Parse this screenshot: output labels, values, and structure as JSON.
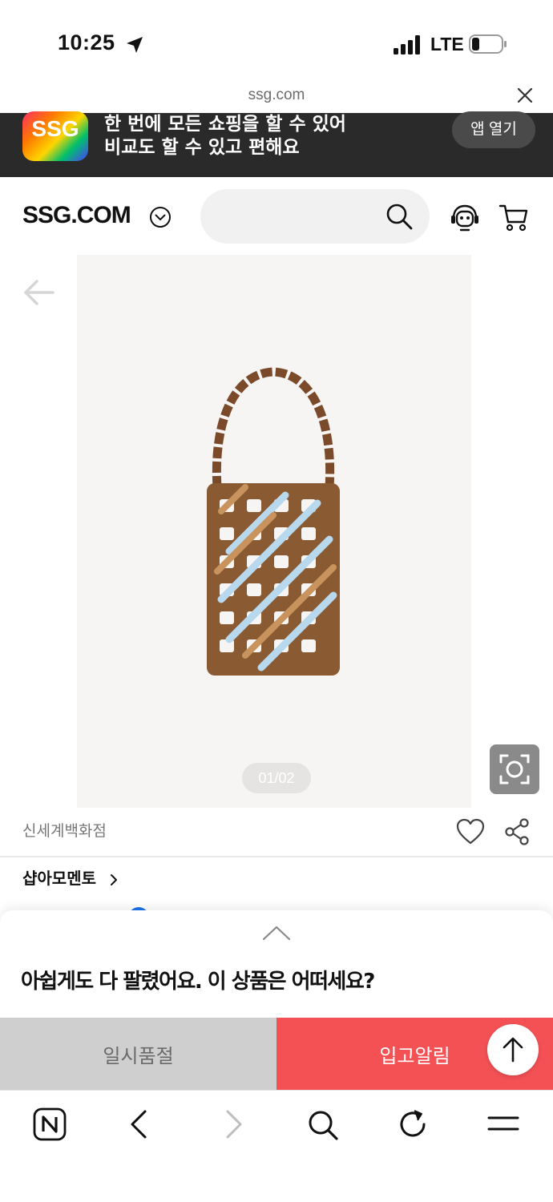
{
  "status_bar": {
    "time": "10:25",
    "network": "LTE"
  },
  "url_bar": {
    "domain": "ssg.com"
  },
  "app_banner": {
    "logo_text": "SSG",
    "line1": "한 번에 모든 쇼핑을 할 수 있어",
    "line2": "비교도 할 수 있고 편해요",
    "open_app_label": "앱 열기"
  },
  "header": {
    "logo": "SSG.COM"
  },
  "gallery": {
    "counter": "01/02"
  },
  "product": {
    "seller": "신세계백화점",
    "brand": "샵아모멘토"
  },
  "sheet": {
    "message": "아쉽게도 다 팔렸어요. 이 상품은 어떠세요?"
  },
  "actions": {
    "soldout_label": "일시품절",
    "notify_label": "입고알림"
  },
  "colors": {
    "notify": "#f45155",
    "soldout": "#cfcfcf",
    "banner_bg": "#2a2a2a"
  }
}
